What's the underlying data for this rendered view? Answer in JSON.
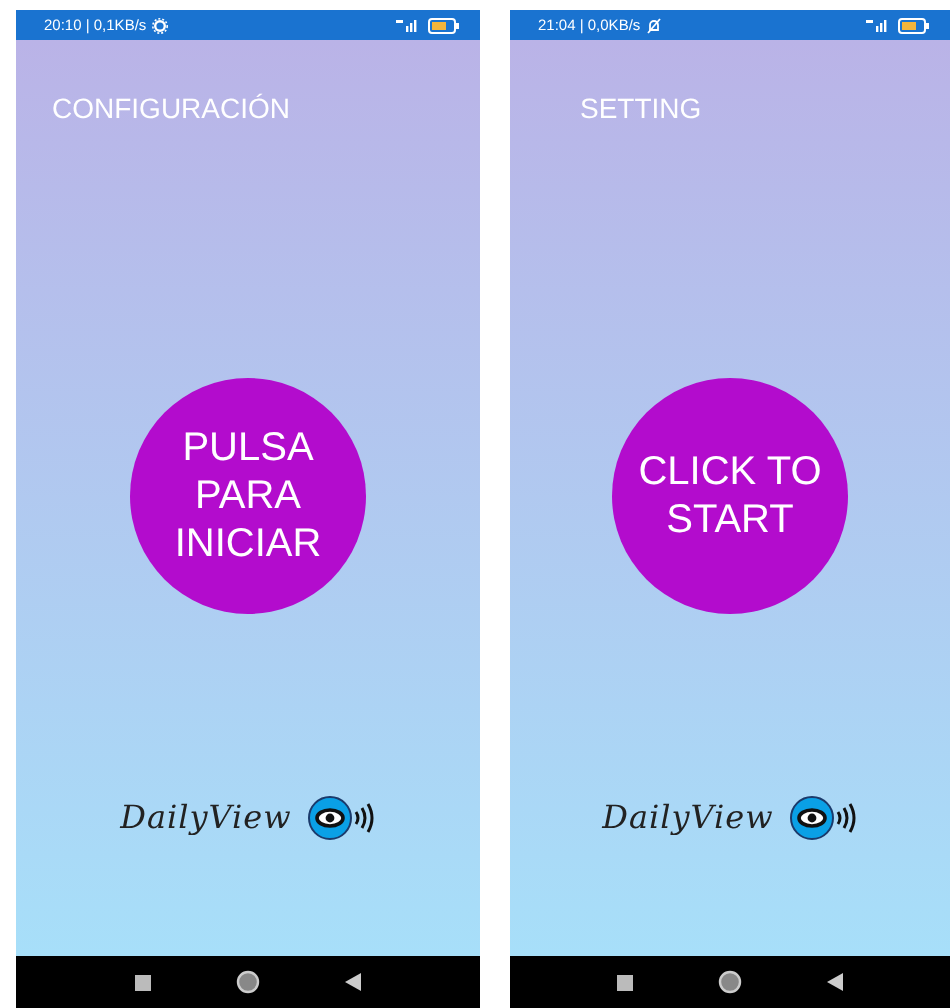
{
  "phones": [
    {
      "status_bar": {
        "time": "20:10 | 0,1KB/s",
        "kind": "gear"
      },
      "settings_label": "CONFIGURACIÓN",
      "start_button": "PULSA PARA INICIAR",
      "logo_text": "DailyView"
    },
    {
      "status_bar": {
        "time": "21:04 | 0,0KB/s",
        "kind": "muted"
      },
      "settings_label": "SETTING",
      "start_button": "CLICK TO START",
      "logo_text": "DailyView"
    }
  ]
}
